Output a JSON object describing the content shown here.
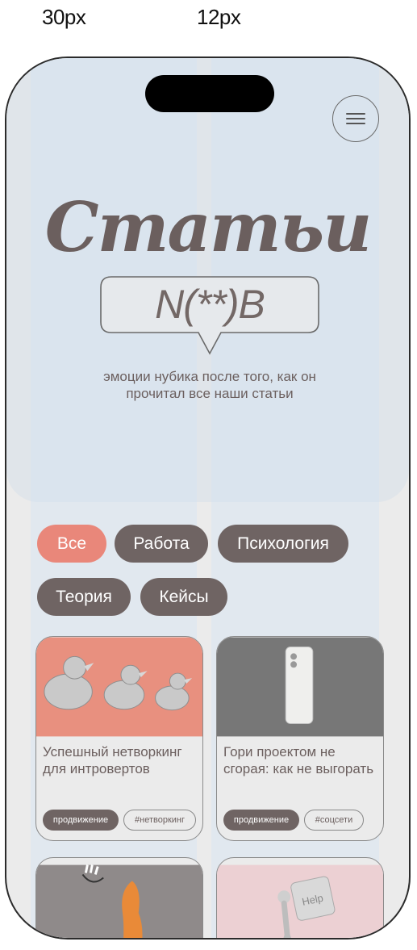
{
  "annotations": {
    "margin_label": "30px",
    "gutter_label": "12px"
  },
  "header": {
    "menu_icon": "hamburger-icon"
  },
  "hero": {
    "title": "Статьи",
    "badge": "N(**)B",
    "subtitle": "эмоции нубика после того, как он прочитал все наши статьи"
  },
  "filters": {
    "items": [
      {
        "label": "Все",
        "active": true
      },
      {
        "label": "Работа",
        "active": false
      },
      {
        "label": "Психология",
        "active": false
      },
      {
        "label": "Теория",
        "active": false
      },
      {
        "label": "Кейсы",
        "active": false
      }
    ]
  },
  "cards": [
    {
      "title": "Успешный нетворкинг для интровертов",
      "tags": [
        "продвижение",
        "#нетворкинг"
      ],
      "image": "silver-ducks-image"
    },
    {
      "title": "Гори проектом не сгорая: как не выгорать",
      "tags": [
        "продвижение",
        "#соцсети"
      ],
      "image": "phone-image"
    },
    {
      "title": "",
      "tags": [],
      "image": "hand-figure-image"
    },
    {
      "title": "",
      "tags": [],
      "image": "help-key-image",
      "image_text": "Help"
    }
  ],
  "colors": {
    "accent": "#e9877a",
    "chip": "#6f6463",
    "text": "#6b5f5e"
  }
}
